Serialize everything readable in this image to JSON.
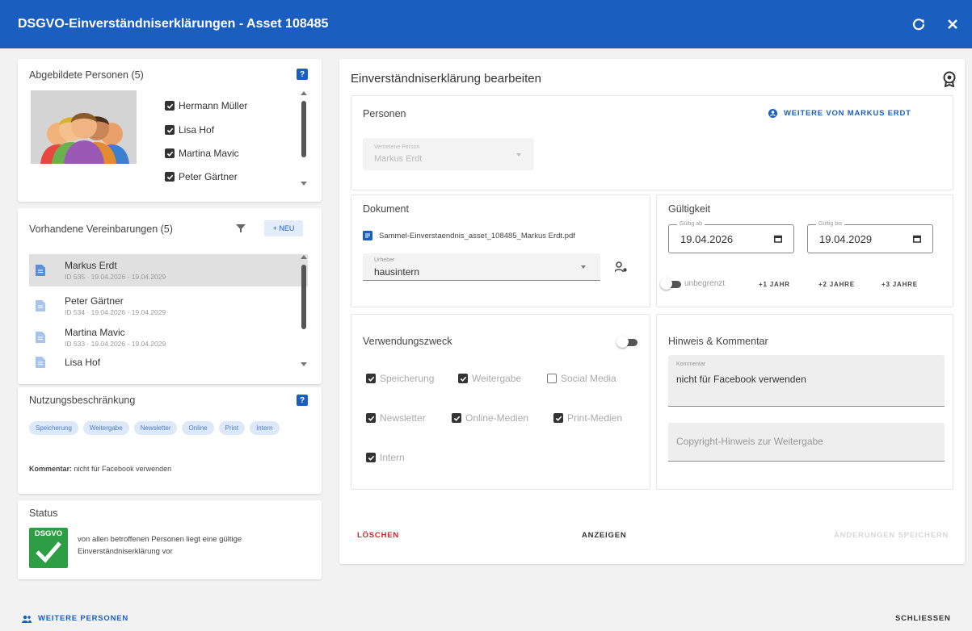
{
  "window": {
    "title": "DSGVO-Einverständniserklärungen - Asset 108485"
  },
  "persons_panel": {
    "title": "Abgebildete Personen (5)",
    "help": "?",
    "persons": [
      {
        "label": "Hermann Müller",
        "checked": true
      },
      {
        "label": "Lisa Hof",
        "checked": true
      },
      {
        "label": "Martina Mavic",
        "checked": true
      },
      {
        "label": "Peter Gärtner",
        "checked": true
      }
    ]
  },
  "agreements_panel": {
    "title": "Vorhandene Vereinbarungen (5)",
    "new_label": "+ NEU",
    "items": [
      {
        "name": "Markus Erdt",
        "meta": "ID 535 · 19.04.2026 - 19.04.2029"
      },
      {
        "name": "Peter Gärtner",
        "meta": "ID 534 · 19.04.2026 - 19.04.2029"
      },
      {
        "name": "Martina Mavic",
        "meta": "ID 533 · 19.04.2026 - 19.04.2029"
      },
      {
        "name": "Lisa Hof",
        "meta": ""
      }
    ]
  },
  "restriction_panel": {
    "title": "Nutzungsbeschränkung",
    "help": "?",
    "chips": [
      "Speicherung",
      "Weitergabe",
      "Newsletter",
      "Online",
      "Print",
      "Intern"
    ],
    "comment_label": "Kommentar:",
    "comment_text": "nicht für Facebook verwenden"
  },
  "status_panel": {
    "title": "Status",
    "badge": "DSGVO",
    "text": "von allen betroffenen Personen liegt eine gültige Einverständniserklärung vor"
  },
  "editor": {
    "title": "Einverständniserklärung bearbeiten",
    "persons": {
      "title": "Personen",
      "more_button": "WEITERE VON MARKUS ERDT",
      "select_label": "Vertretene Person",
      "select_value": "Markus Erdt"
    },
    "document": {
      "title": "Dokument",
      "file": "Sammel-Einverstaendnis_asset_108485_Markus Erdt.pdf",
      "author_label": "Urheber",
      "author_value": "hausintern"
    },
    "validity": {
      "title": "Gültigkeit",
      "from_label": "Gültig ab",
      "from_value": "19.04.2026",
      "to_label": "Gültig bis",
      "to_value": "19.04.2029",
      "unlimited_label": "unbegrenzt",
      "plus1": "+1 JAHR",
      "plus2": "+2 JAHRE",
      "plus3": "+3 JAHRE"
    },
    "purpose": {
      "title": "Verwendungszweck",
      "items": [
        {
          "label": "Speicherung",
          "checked": true
        },
        {
          "label": "Weitergabe",
          "checked": true
        },
        {
          "label": "Social Media",
          "checked": false
        },
        {
          "label": "Newsletter",
          "checked": true
        },
        {
          "label": "Online-Medien",
          "checked": true
        },
        {
          "label": "Print-Medien",
          "checked": true
        },
        {
          "label": "Intern",
          "checked": true
        }
      ]
    },
    "notes": {
      "title": "Hinweis & Kommentar",
      "comment_label": "Kommentar",
      "comment_value": "nicht für Facebook verwenden",
      "copyright_placeholder": "Copyright-Hinweis zur Weitergabe"
    },
    "actions": {
      "delete": "LÖSCHEN",
      "show": "ANZEIGEN",
      "save": "ÄNDERUNGEN SPEICHERN"
    }
  },
  "footer": {
    "more_persons": "WEITERE PERSONEN",
    "close": "SCHLIESSEN"
  },
  "colors": {
    "primary": "#1a5fbf",
    "danger": "#c62828",
    "success": "#2e9e44"
  }
}
